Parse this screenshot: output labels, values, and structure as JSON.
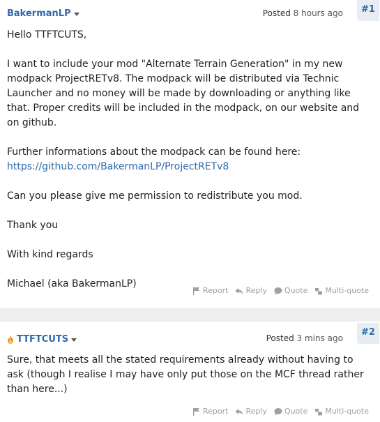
{
  "posts": [
    {
      "number": "#1",
      "author": "BakermanLP",
      "posted_label": "Posted",
      "posted_time": "8 hours ago",
      "paragraphs": [
        "Hello TTFTCUTS,",
        "I want to include your mod \"Alternate Terrain Generation\" in my new modpack ProjectRETv8. The modpack will be distributed via Technic Launcher and no money will be made by downloading or anything like that. Proper credits will be included in the modpack, on our website and on github."
      ],
      "para3_text": "Further informations about the modpack can be found here: ",
      "para3_link": "https://github.com/BakermanLP/ProjectRETv8",
      "paragraphs_after": [
        "Can you please give me permission to redistribute you mod.",
        "Thank you",
        "With kind regards",
        "Michael (aka BakermanLP)"
      ],
      "actions": {
        "report": "Report",
        "reply": "Reply",
        "quote": "Quote",
        "multiquote": "Multi-quote"
      }
    },
    {
      "number": "#2",
      "author": "TTFTCUTS",
      "posted_label": "Posted",
      "posted_time": "3 mins ago",
      "paragraphs": [
        "Sure, that meets all the stated requirements already without having to ask (though I realise I may have only put those on the MCF thread rather than here...)"
      ],
      "actions": {
        "report": "Report",
        "reply": "Reply",
        "quote": "Quote",
        "multiquote": "Multi-quote"
      }
    }
  ],
  "icons": {
    "flag": "flag-icon",
    "reply": "reply-arrow-icon",
    "quote": "speech-bubble-icon",
    "multiquote": "multi-quote-icon",
    "flame": "flame-icon"
  },
  "colors": {
    "link": "#2f6aaa",
    "muted": "#a0a0a0",
    "background": "#eeeeee"
  }
}
